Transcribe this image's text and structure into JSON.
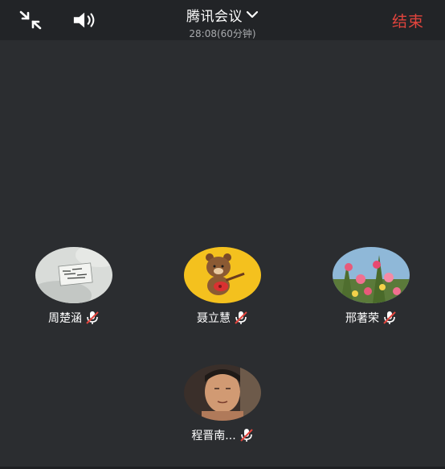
{
  "header": {
    "title": "腾讯会议",
    "subtitle": "28:08(60分钟)",
    "end_label": "结束",
    "end_color": "#e2443d",
    "icons": [
      "shrink-icon",
      "speaker-icon",
      "chevron-down-icon"
    ]
  },
  "participants": [
    {
      "name": "周楚涵",
      "avatar": "avatar-white-badge",
      "mic": "muted"
    },
    {
      "name": "聂立慧",
      "avatar": "avatar-brown-bear",
      "mic": "muted"
    },
    {
      "name": "邢著荣",
      "avatar": "avatar-flowers",
      "mic": "muted"
    },
    {
      "name": "程晋南...",
      "avatar": "avatar-person",
      "mic": "muted"
    }
  ]
}
